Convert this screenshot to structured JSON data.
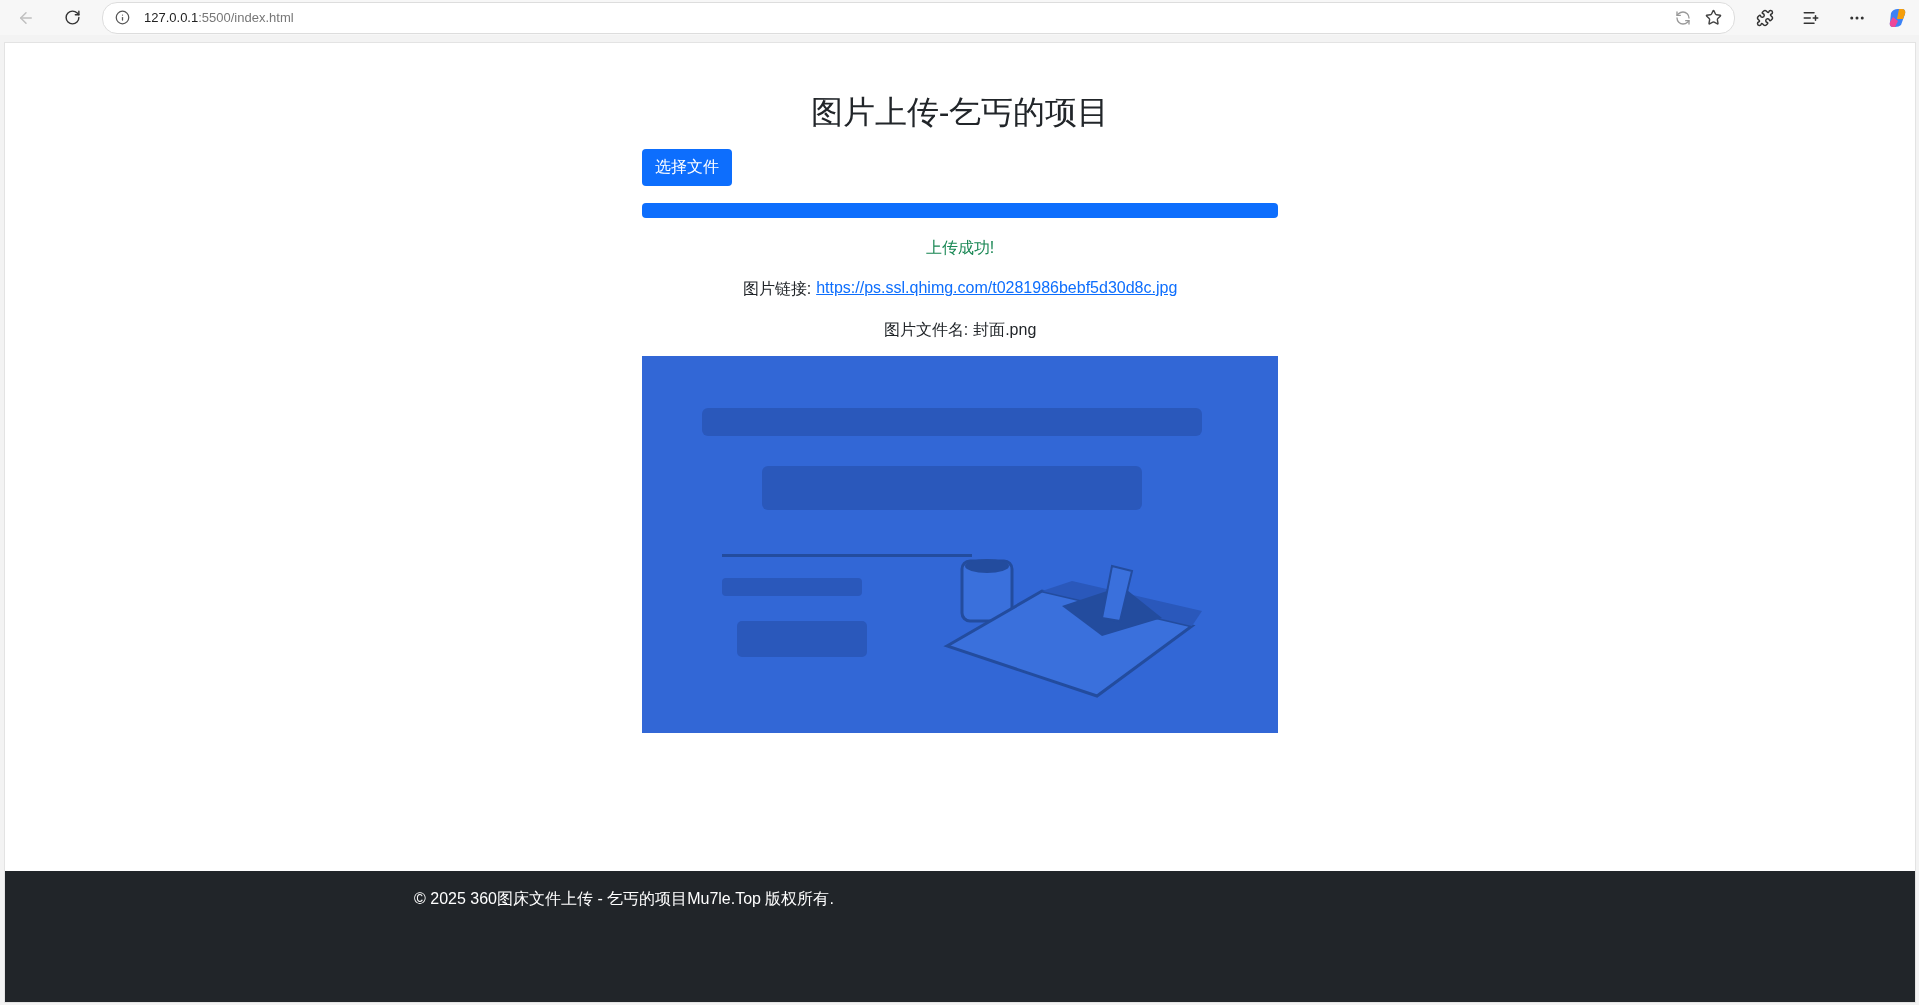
{
  "browser": {
    "url_host": "127.0.0.1",
    "url_path": ":5500/index.html",
    "back_disabled": true
  },
  "page": {
    "title": "图片上传-乞丐的项目",
    "choose_button": "选择文件",
    "progress": {
      "level": 1
    },
    "status": "上传成功!",
    "link_label": "图片链接:",
    "link": "https://ps.ssl.qhimg.com/t0281986bebf5d30d8c.jpg",
    "filename_label": "图片文件名:",
    "filename": "封面.png"
  },
  "footer": {
    "text": "© 2025 360图床文件上传 - 乞丐的项目Mu7le.Top 版权所有."
  }
}
